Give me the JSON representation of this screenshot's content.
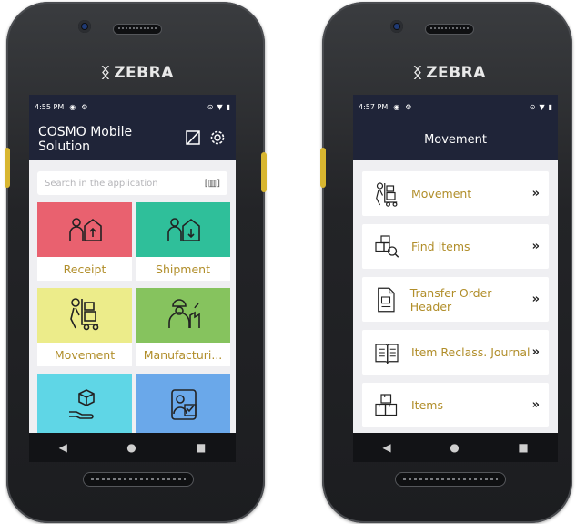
{
  "left_phone": {
    "brand": "ZEBRA",
    "status": {
      "time": "4:55 PM"
    },
    "app_title": "COSMO Mobile Solution",
    "search": {
      "placeholder": "Search in the application"
    },
    "tiles": [
      {
        "label": "Receipt",
        "color": "#e9616f"
      },
      {
        "label": "Shipment",
        "color": "#2fbf9a"
      },
      {
        "label": "Movement",
        "color": "#ecec8a"
      },
      {
        "label": "Manufacturi...",
        "color": "#86c35e"
      },
      {
        "label": "",
        "color": "#5fd6e6"
      },
      {
        "label": "",
        "color": "#6aa8ea"
      }
    ]
  },
  "right_phone": {
    "brand": "ZEBRA",
    "status": {
      "time": "4:57 PM"
    },
    "title": "Movement",
    "items": [
      {
        "label": "Movement"
      },
      {
        "label": "Find Items"
      },
      {
        "label": "Transfer Order Header"
      },
      {
        "label": "Item Reclass. Journal"
      },
      {
        "label": "Items"
      }
    ],
    "chevron": "»"
  },
  "colors": {
    "appbar": "#1f2438",
    "accent_text": "#b18e2a",
    "screen_bg": "#efeff2"
  }
}
